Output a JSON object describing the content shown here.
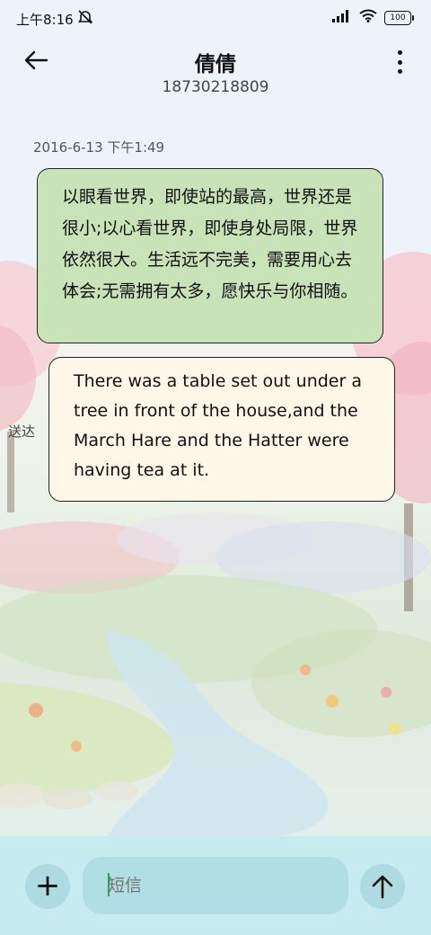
{
  "status_bar": {
    "time": "上午8:16",
    "battery": "100"
  },
  "header": {
    "contact_name": "倩倩",
    "phone_number": "18730218809"
  },
  "conversation": {
    "timestamp": "2016-6-13 下午1:49",
    "messages": [
      {
        "text": "以眼看世界，即使站的最高，世界还是很小;以心看世界，即使身处局限，世界依然很大。生活远不完美，需要用心去体会;无需拥有太多，愿快乐与你相随。"
      },
      {
        "text": "There was a table set out under a tree in front of the house,and the March Hare and the Hatter were having tea at it.",
        "status": "送达"
      }
    ]
  },
  "composer": {
    "placeholder": "短信"
  },
  "colors": {
    "received_bubble": "#c9e3b9",
    "sent_bubble": "#fdf7e7",
    "composer_bar": "#c6ecf1"
  },
  "icons": [
    "back-arrow-icon",
    "more-vert-icon",
    "plus-icon",
    "send-arrow-icon",
    "signal-icon",
    "wifi-icon",
    "mute-icon"
  ]
}
